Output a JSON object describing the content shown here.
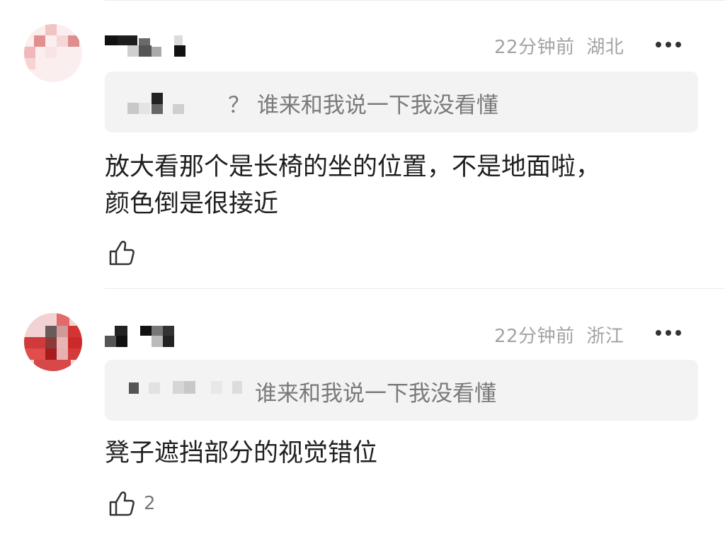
{
  "comments": [
    {
      "time": "22分钟前",
      "location": "湖北",
      "reply_quote": "？ 谁来和我说一下我没看懂",
      "text_line1": "放大看那个是长椅的坐的位置，不是地面啦，",
      "text_line2": "颜色倒是很接近",
      "like_count": ""
    },
    {
      "time": "22分钟前",
      "location": "浙江",
      "reply_quote": "谁来和我说一下我没看懂",
      "text_line1": "凳子遮挡部分的视觉错位",
      "text_line2": "",
      "like_count": "2"
    }
  ],
  "icons": {
    "more": "more-dots-icon",
    "like": "thumbs-up-icon"
  },
  "colors": {
    "meta_text": "#a3a3a3",
    "quote_bg": "#f3f3f3",
    "body_text": "#1f1f1f",
    "avatar1_tone": "#e8a6a6",
    "avatar2_tone": "#cc2a2a"
  }
}
